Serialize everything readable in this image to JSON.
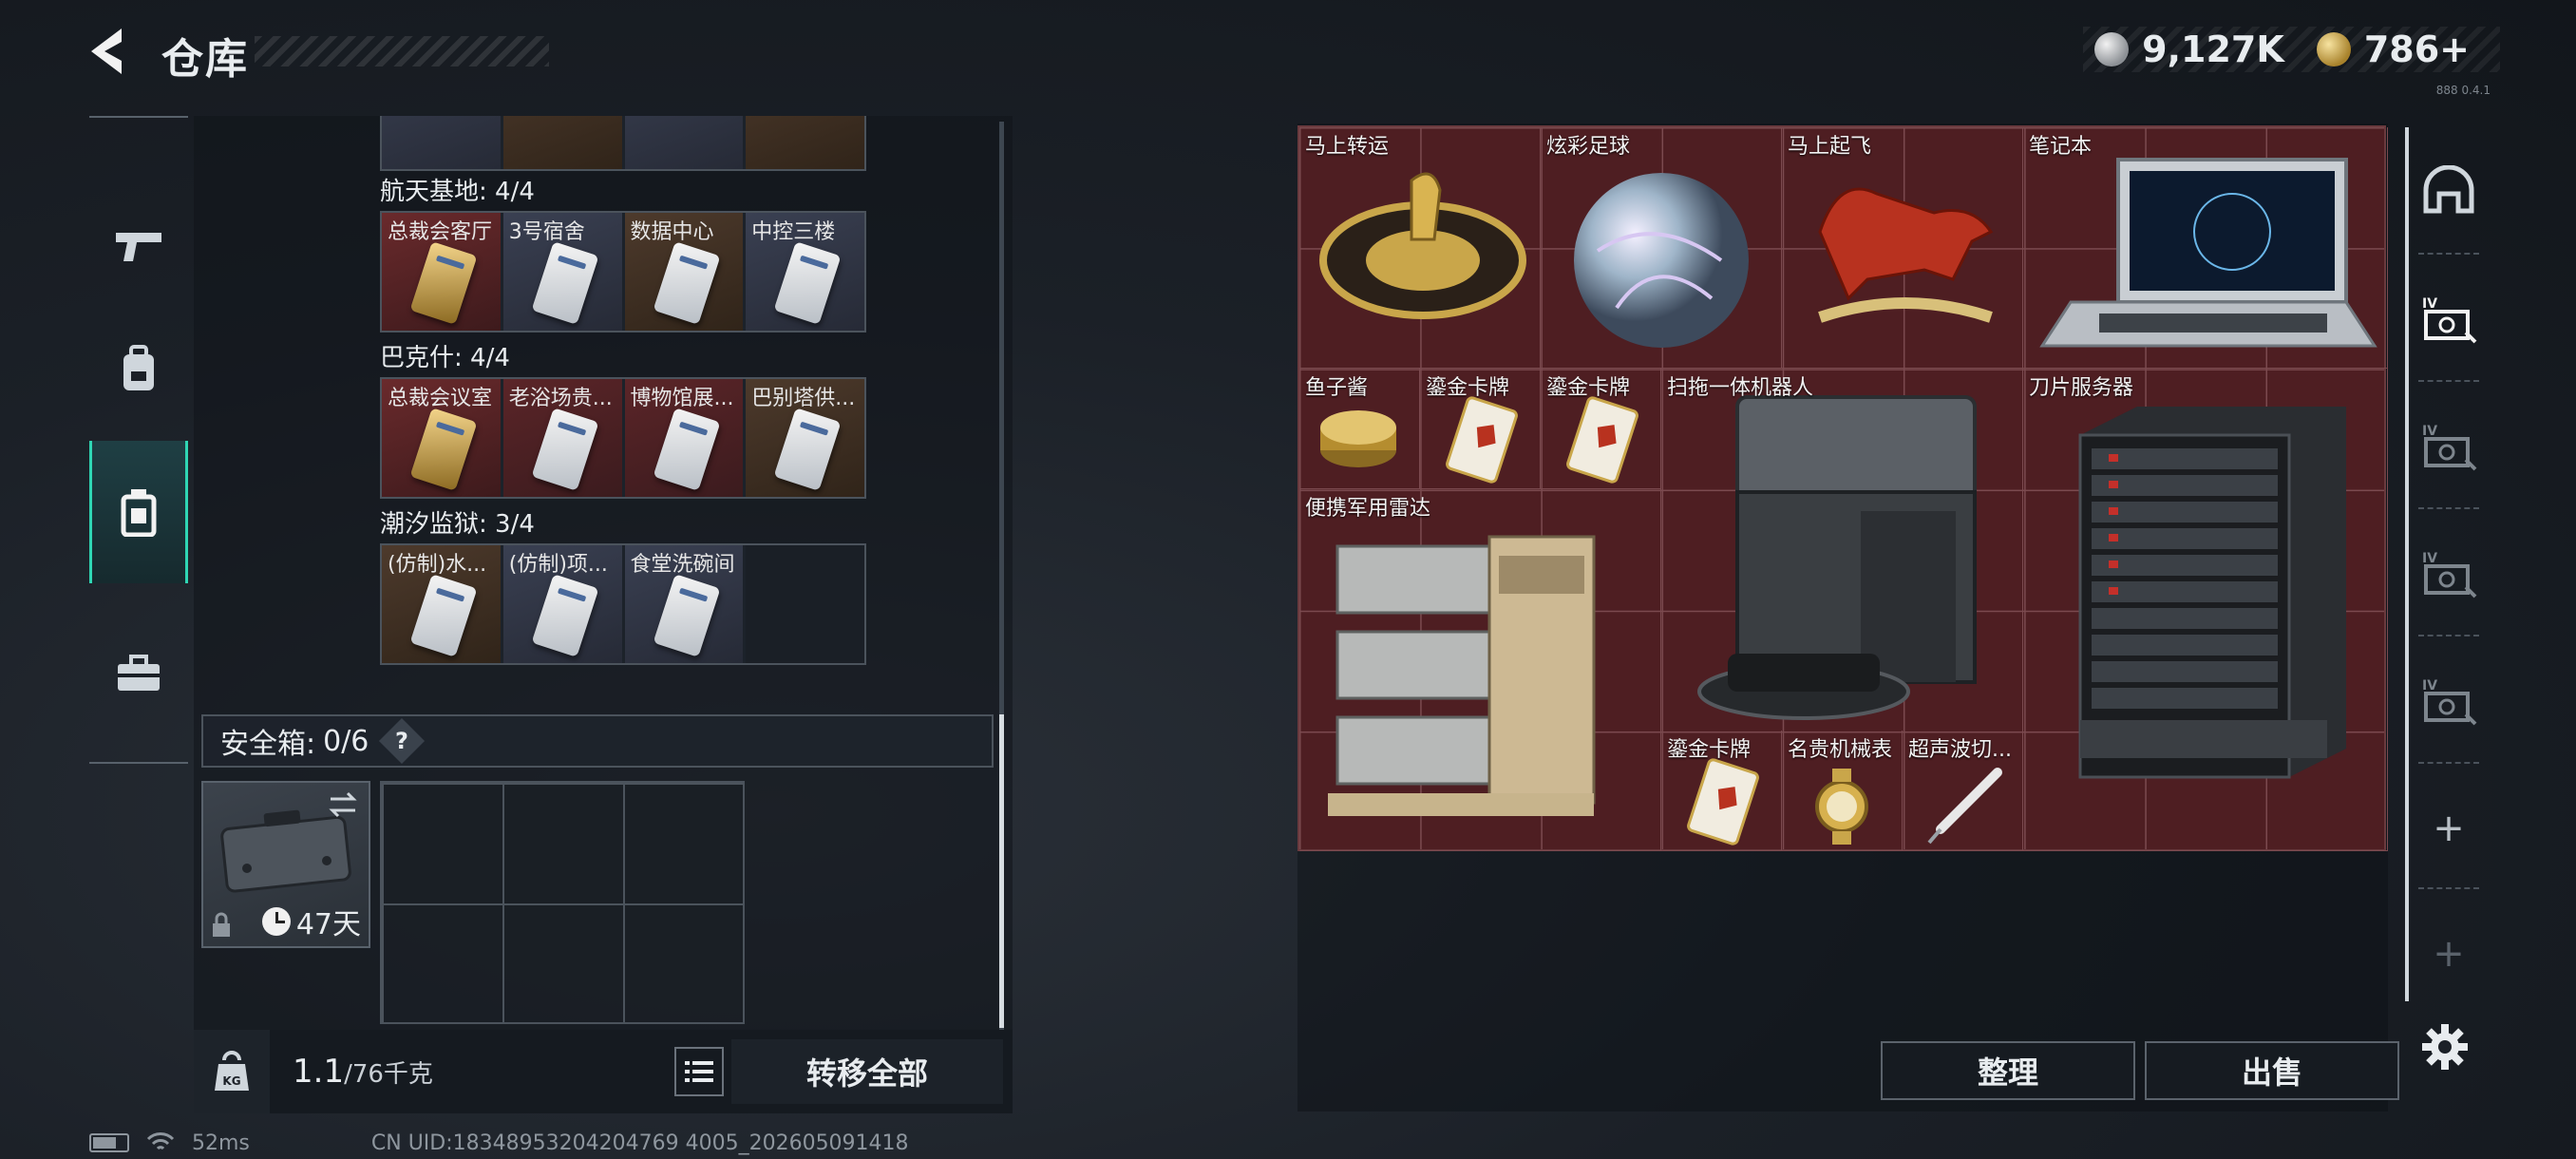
{
  "header": {
    "title": "仓库",
    "currency": [
      {
        "icon": "silver-coin-icon",
        "value": "9,127K"
      },
      {
        "icon": "gold-coin-icon",
        "value": "786+"
      }
    ],
    "version": "888 0.4.1"
  },
  "left_tabs": [
    {
      "name": "weapons",
      "icon": "gun-icon",
      "active": false
    },
    {
      "name": "equipment",
      "icon": "backpack-icon",
      "active": false
    },
    {
      "name": "items",
      "icon": "bag-icon",
      "active": true
    },
    {
      "name": "toolbox",
      "icon": "toolbox-icon",
      "active": false
    }
  ],
  "storage": {
    "groups": [
      {
        "title": "航天基地: 4/4",
        "cards": [
          {
            "label": "总裁会客厅",
            "style": "gold"
          },
          {
            "label": "3号宿舍",
            "style": "blue"
          },
          {
            "label": "数据中心",
            "style": "brown"
          },
          {
            "label": "中控三楼",
            "style": "blue"
          }
        ]
      },
      {
        "title": "巴克什: 4/4",
        "cards": [
          {
            "label": "总裁会议室",
            "style": "gold"
          },
          {
            "label": "老浴场贵...",
            "style": "red"
          },
          {
            "label": "博物馆展...",
            "style": "red"
          },
          {
            "label": "巴别塔供...",
            "style": "brown"
          }
        ]
      },
      {
        "title": "潮汐监狱: 3/4",
        "cards": [
          {
            "label": "(仿制)水...",
            "style": "brown"
          },
          {
            "label": "(仿制)项...",
            "style": "blue"
          },
          {
            "label": "食堂洗碗间",
            "style": "blue"
          },
          {
            "label": "",
            "style": "empty"
          }
        ]
      }
    ]
  },
  "safe_box": {
    "label": "安全箱:",
    "count": "0/6",
    "help": "?",
    "days": "47天"
  },
  "footer": {
    "weight_value": "1.1",
    "weight_max": "/76千克",
    "transfer_all": "转移全部"
  },
  "status": {
    "ping": "52ms",
    "uid": "CN UID:18348953204204769 4005_202605091418"
  },
  "inventory": {
    "items": [
      {
        "label": "马上转运"
      },
      {
        "label": "炫彩足球"
      },
      {
        "label": "马上起飞"
      },
      {
        "label": "笔记本"
      },
      {
        "label": "鱼子酱"
      },
      {
        "label": "鎏金卡牌"
      },
      {
        "label": "鎏金卡牌"
      },
      {
        "label": "扫拖一体机器人"
      },
      {
        "label": "刀片服务器"
      },
      {
        "label": "便携军用雷达"
      },
      {
        "label": "鎏金卡牌"
      },
      {
        "label": "名贵机械表"
      },
      {
        "label": "超声波切..."
      }
    ],
    "sort_button": "整理",
    "sell_button": "出售"
  },
  "colors": {
    "accent": "#2fd6b4",
    "inventory_bg": "#4e1e22"
  }
}
